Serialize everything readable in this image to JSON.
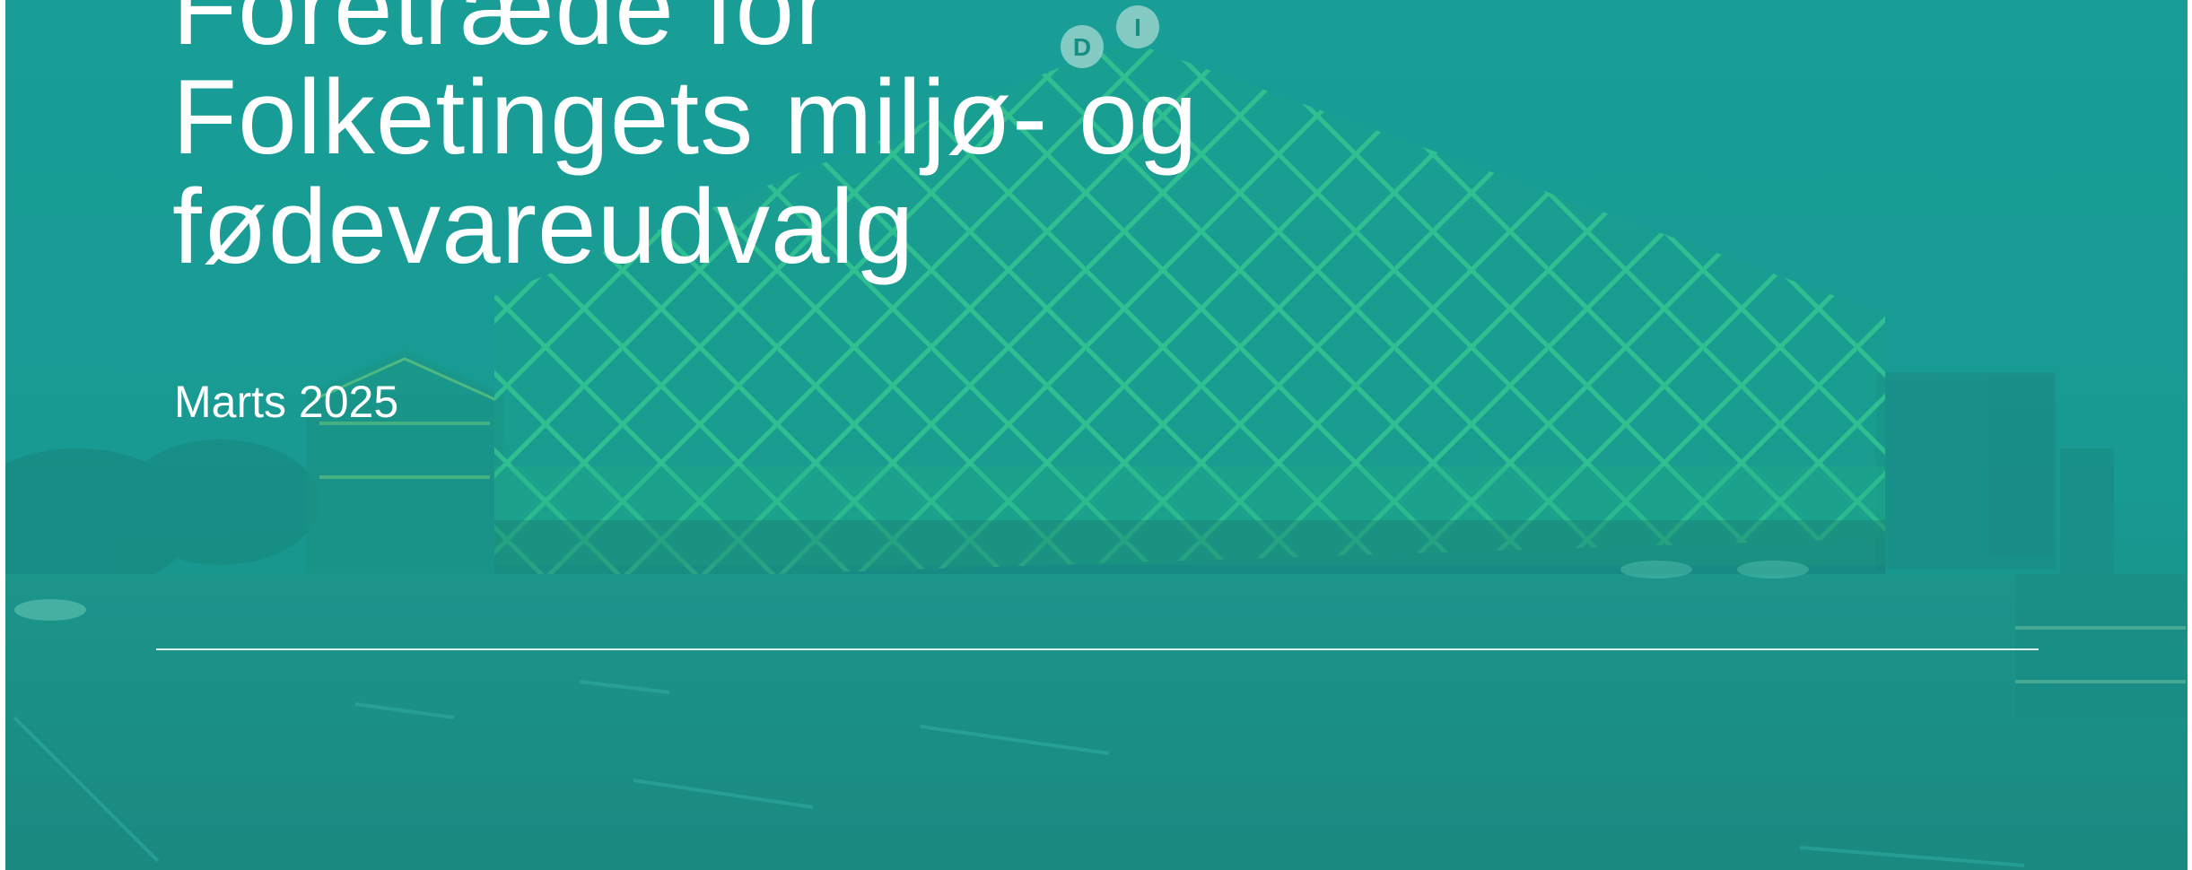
{
  "slide": {
    "title_lines": [
      "Foretræde for",
      "Folketingets miljø- og",
      "fødevareudvalg"
    ],
    "date": "Marts 2025",
    "building_sign": "DI"
  },
  "colors": {
    "overlay": "#1a9a95",
    "facade": "#2fd39a",
    "text": "#ffffff"
  }
}
